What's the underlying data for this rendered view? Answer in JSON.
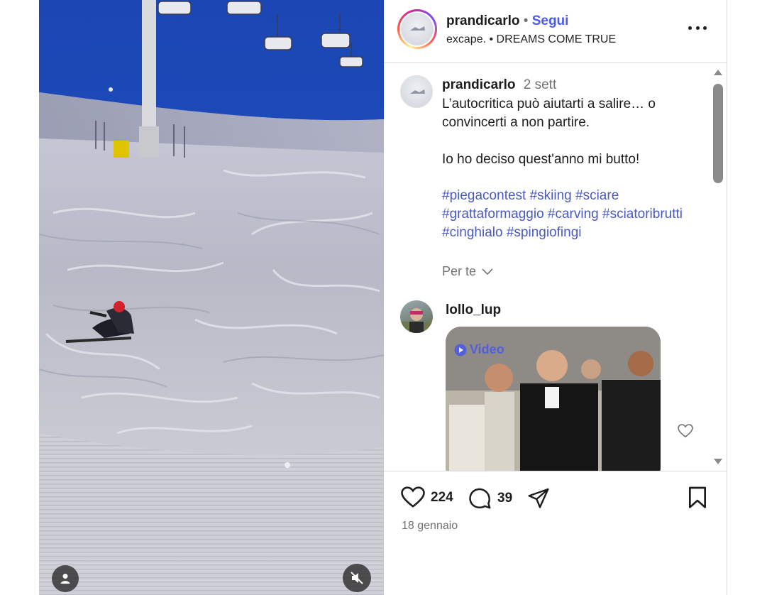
{
  "post": {
    "author": "prandicarlo",
    "follow_label": "Segui",
    "separator": "•",
    "subtitle": "excape. • DREAMS COME TRUE",
    "more_label": "•••"
  },
  "caption": {
    "username": "prandicarlo",
    "time_ago": "2 sett",
    "lines": [
      "L’autocritica può aiutarti a salire… o convincerti a non partire.",
      "Io ho deciso quest'anno mi butto!"
    ],
    "hashtags": "#piegacontest #skiing #sciare #grattaformaggio #carving #sciatoribrutti #cinghialo #spingiofingi",
    "for_you_label": "Per te"
  },
  "comment": {
    "username": "lollo_lup",
    "media_label": "Video"
  },
  "actions": {
    "likes": "224",
    "comments": "39",
    "date": "18 gennaio"
  },
  "icons": {
    "user_tag": "user-icon",
    "mute": "speaker-muted-icon",
    "like": "heart-icon",
    "comment": "speech-bubble-icon",
    "share": "paper-plane-icon",
    "save": "bookmark-icon",
    "chevron": "chevron-down-icon"
  },
  "colors": {
    "link": "#4a59c4",
    "follow": "#4a59f2",
    "muted_text": "#737373",
    "divider": "#dbdbdb"
  }
}
